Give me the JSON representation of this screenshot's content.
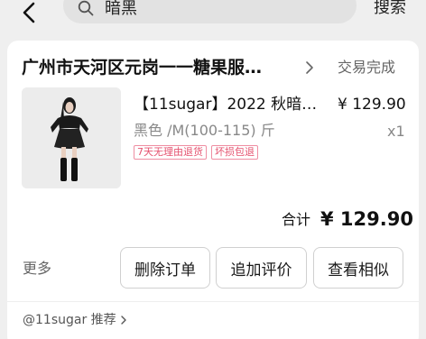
{
  "search": {
    "query": "暗黑",
    "button_label": "搜索"
  },
  "order": {
    "shop_name": "广州市天河区元岗一一糖果服…",
    "status": "交易完成",
    "product": {
      "title": "【11sugar】2022 秋暗…",
      "price": "¥ 129.90",
      "spec": "黑色 /M(100-115) 斤",
      "quantity": "x1",
      "tags": [
        "7天无理由退货",
        "坏损包退"
      ]
    },
    "total_label": "合计",
    "total_value": "¥ 129.90"
  },
  "actions": {
    "more_label": "更多",
    "delete_label": "删除订单",
    "review_label": "追加评价",
    "similar_label": "查看相似"
  },
  "recommend": {
    "label": "@11sugar 推荐"
  },
  "colors": {
    "tag_border": "#ef8ea2",
    "tag_text": "#e5526f",
    "background": "#efefef",
    "card": "#ffffff"
  },
  "icons": {
    "back": "back-arrow-icon",
    "search": "search-icon",
    "shop_chevron": "chevron-right-icon",
    "recommend_chevron": "chevron-right-icon"
  }
}
